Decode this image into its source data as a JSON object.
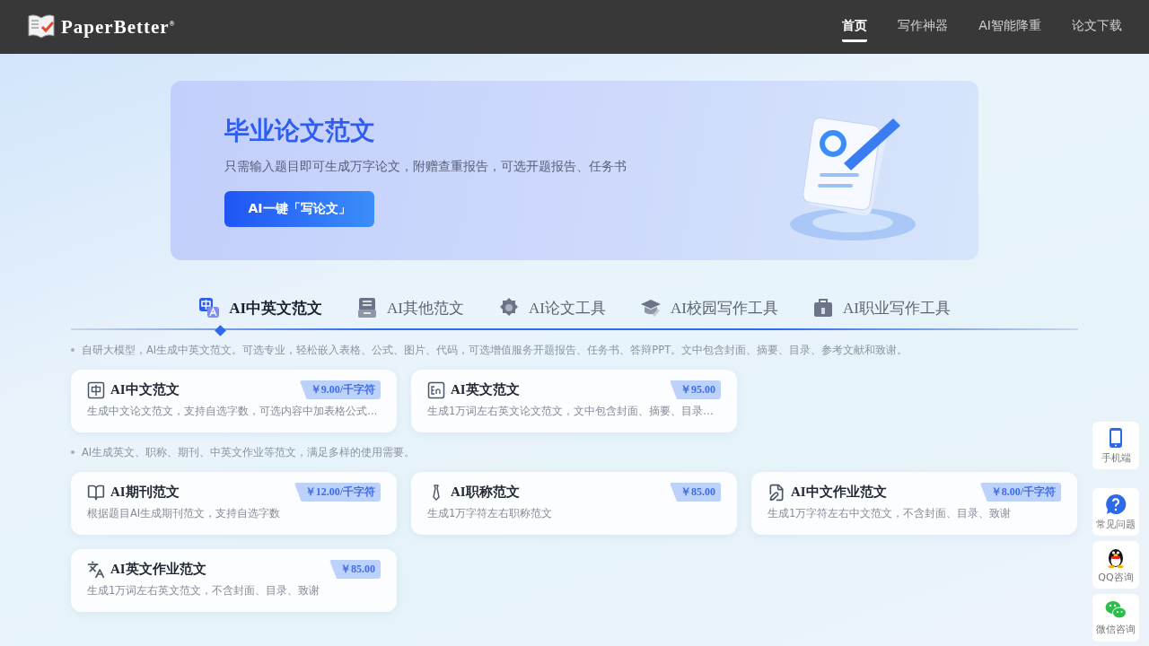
{
  "header": {
    "logo_text": "PaperBetter",
    "logo_mark": "®",
    "nav": [
      {
        "label": "首页",
        "selected": true
      },
      {
        "label": "写作神器",
        "selected": false
      },
      {
        "label": "AI智能降重",
        "selected": false
      },
      {
        "label": "论文下载",
        "selected": false
      }
    ]
  },
  "banner": {
    "title": "毕业论文范文",
    "subtitle": "只需输入题目即可生成万字论文，附赠查重报告，可选开题报告、任务书",
    "button": "AI一键「写论文」"
  },
  "tabs": [
    {
      "label": "AI中英文范文",
      "kind": "translate",
      "selected": true
    },
    {
      "label": "AI其他范文",
      "kind": "stack",
      "selected": false
    },
    {
      "label": "AI论文工具",
      "kind": "gear",
      "selected": false
    },
    {
      "label": "AI校园写作工具",
      "kind": "cap",
      "selected": false
    },
    {
      "label": "AI职业写作工具",
      "kind": "briefcase",
      "selected": false
    }
  ],
  "sections": [
    {
      "note": "自研大模型，AI生成中英文范文。可选专业，轻松嵌入表格、公式、图片、代码，可选增值服务开题报告、任务书、答辩PPT。文中包含封面、摘要、目录、参考文献和致谢。",
      "cards": [
        {
          "kind": "chinese",
          "title": "AI中文范文",
          "price": "￥9.00/千字符",
          "desc": "生成中文论文范文，支持自选字数，可选内容中加表格公式…"
        },
        {
          "kind": "english",
          "title": "AI英文范文",
          "price": "￥95.00",
          "desc": "生成1万词左右英文论文范文，文中包含封面、摘要、目录…"
        }
      ]
    },
    {
      "note": "AI生成英文、职称、期刊、中英文作业等范文，满足多样的使用需要。",
      "cards": [
        {
          "kind": "journal",
          "title": "AI期刊范文",
          "price": "￥12.00/千字符",
          "desc": "根据题目AI生成期刊范文，支持自选字数"
        },
        {
          "kind": "professional",
          "title": "AI职称范文",
          "price": "￥85.00",
          "desc": "生成1万字符左右职称范文"
        },
        {
          "kind": "homework",
          "title": "AI中文作业范文",
          "price": "￥8.00/千字符",
          "desc": "生成1万字符左右中文范文，不含封面、目录、致谢"
        },
        {
          "kind": "translation",
          "title": "AI英文作业范文",
          "price": "￥85.00",
          "desc": "生成1万词左右英文范文，不含封面、目录、致谢"
        }
      ]
    }
  ],
  "side": [
    {
      "kind": "mobile",
      "label": "手机端"
    },
    {
      "kind": "faq",
      "label": "常见问题"
    },
    {
      "kind": "qq",
      "label": "QQ咨询"
    },
    {
      "kind": "wechat",
      "label": "微信咨询"
    }
  ]
}
